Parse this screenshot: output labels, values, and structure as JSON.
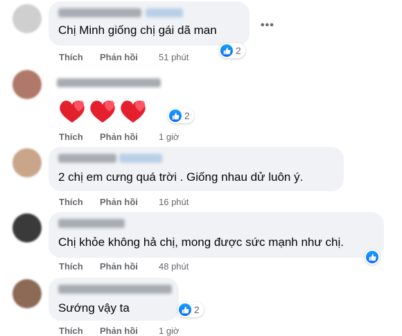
{
  "actions": {
    "like": "Thích",
    "reply": "Phản hồi"
  },
  "colors": {
    "like_blue": "#0866ff",
    "bubble_bg": "#f0f2f5",
    "meta_gray": "#65676b",
    "heart_red": "#e5202e"
  },
  "icons": {
    "reaction": "like-icon",
    "more": "ellipsis-icon",
    "hearts": "heart-emoji"
  },
  "more_label": "•••",
  "comments": [
    {
      "text": "Chị Minh giống chị gái dã man",
      "time": "51 phút",
      "reactions": "2"
    },
    {
      "text": "",
      "emoji": "hearts",
      "emoji_count": 3,
      "time": "1 giờ",
      "reactions": "2"
    },
    {
      "text": "2 chị em cưng quá trời . Giống nhau dử luôn ý.",
      "time": "16 phút",
      "reactions": ""
    },
    {
      "text": "Chị khỏe không hả chị, mong được sức mạnh như chị.",
      "time": "48 phút",
      "reactions": ""
    },
    {
      "text": "Sướng vậy ta",
      "time": "1 giờ",
      "reactions": "2"
    }
  ]
}
